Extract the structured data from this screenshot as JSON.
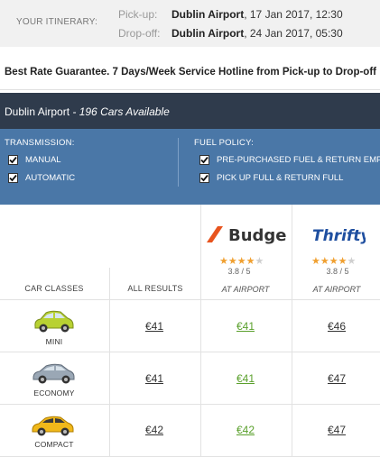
{
  "itinerary": {
    "label": "YOUR ITINERARY:",
    "pickup": {
      "key": "Pick-up:",
      "place": "Dublin Airport",
      "date": ", 17 Jan 2017, 12:30"
    },
    "dropoff": {
      "key": "Drop-off:",
      "place": "Dublin Airport",
      "date": ", 24 Jan 2017, 05:30"
    }
  },
  "guarantee": "Best Rate Guarantee. 7 Days/Week Service Hotline from Pick-up to Drop-off",
  "location": {
    "name": "Dublin Airport",
    "availability": " - 196 Cars Available"
  },
  "filters": {
    "transmission": {
      "title": "TRANSMISSION:",
      "options": [
        "MANUAL",
        "AUTOMATIC"
      ]
    },
    "fuel": {
      "title": "FUEL POLICY:",
      "options": [
        "PRE-PURCHASED FUEL & RETURN EMPTY",
        "PICK UP FULL & RETURN FULL"
      ]
    }
  },
  "table": {
    "col_car_classes": "CAR CLASSES",
    "col_all_results": "ALL RESULTS",
    "suppliers": [
      {
        "name": "Budget",
        "rating": "3.8 / 5",
        "stars": 4,
        "location": "AT AIRPORT",
        "color": "#e8541e"
      },
      {
        "name": "Thrifty",
        "rating": "3.8 / 5",
        "stars": 4,
        "location": "AT AIRPORT",
        "color": "#1f4fa0"
      }
    ],
    "rows": [
      {
        "class": "MINI",
        "all": "€41",
        "budget": "€41",
        "thrifty": "€46",
        "car_color": "#b8d132"
      },
      {
        "class": "ECONOMY",
        "all": "€41",
        "budget": "€41",
        "thrifty": "€47",
        "car_color": "#9aa7b5"
      },
      {
        "class": "COMPACT",
        "all": "€42",
        "budget": "€42",
        "thrifty": "€47",
        "car_color": "#f0b81a"
      }
    ]
  },
  "colors": {
    "best_price": "#5aa02c",
    "header_dark": "#2f3b4c",
    "filter_blue": "#4a77a7"
  }
}
